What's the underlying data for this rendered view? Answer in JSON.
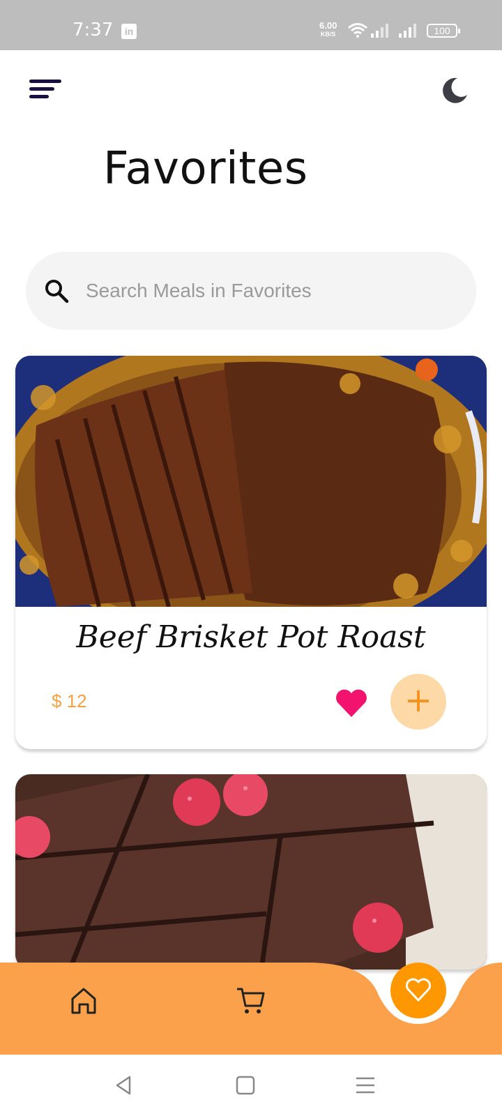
{
  "status_bar": {
    "time": "7:37",
    "app_icon": "linkedin-icon",
    "net_speed": "6.00",
    "net_unit": "KB/S",
    "battery": "100"
  },
  "header": {
    "menu_icon": "menu-icon",
    "theme_icon": "moon-icon",
    "title": "Favorites"
  },
  "search": {
    "placeholder": "Search Meals in Favorites",
    "value": ""
  },
  "meals": [
    {
      "name": "Beef Brisket Pot Roast",
      "price": "$ 12",
      "favorite": true
    },
    {
      "name": "",
      "price": "",
      "favorite": true
    }
  ],
  "bottom_nav": {
    "items": [
      "home-icon",
      "cart-icon",
      "heart-icon"
    ],
    "active": "heart-icon"
  },
  "system_nav": [
    "back-icon",
    "home-square-icon",
    "recents-icon"
  ],
  "colors": {
    "accent": "#FF9800",
    "nav_bar": "#FCA14B",
    "price": "#F5A042",
    "heart": "#F2136E",
    "add_button_bg": "#FDD9A8"
  }
}
